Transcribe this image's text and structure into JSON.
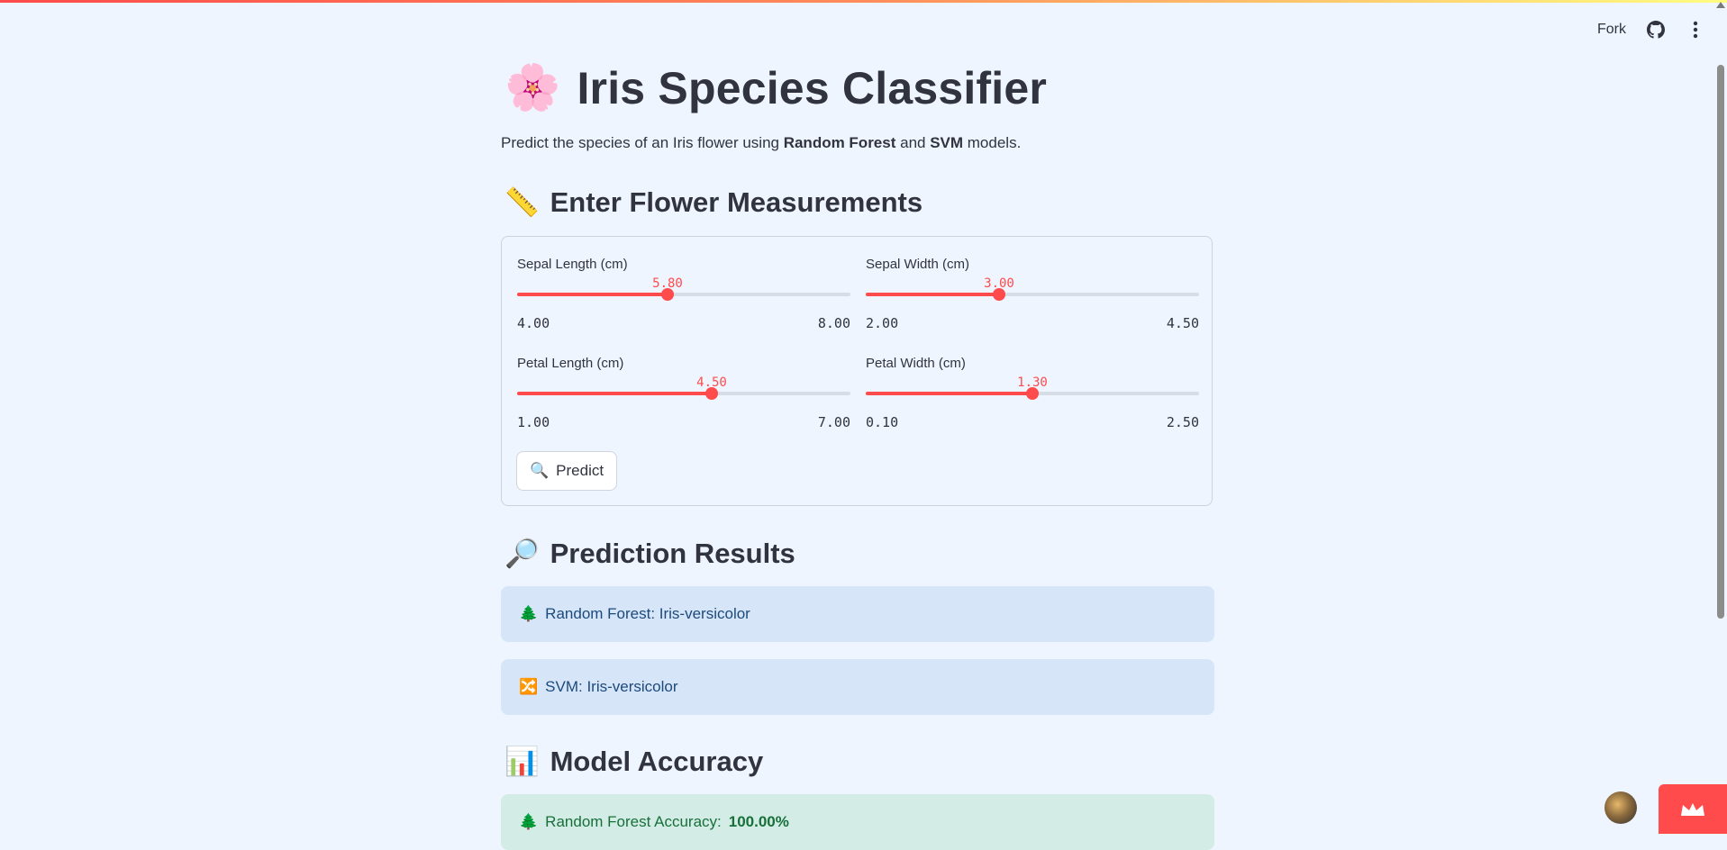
{
  "toolbar": {
    "fork_label": "Fork"
  },
  "title": {
    "emoji": "🌸",
    "text": "Iris Species Classifier"
  },
  "subtitle": {
    "prefix": "Predict the species of an Iris flower using ",
    "rf": "Random Forest",
    "mid": " and ",
    "svm": "SVM",
    "suffix": " models."
  },
  "section_input": {
    "emoji": "📏",
    "text": "Enter Flower Measurements"
  },
  "sliders": [
    {
      "label": "Sepal Length (cm)",
      "value": "5.80",
      "min": "4.00",
      "max": "8.00",
      "fraction": 0.45
    },
    {
      "label": "Sepal Width (cm)",
      "value": "3.00",
      "min": "2.00",
      "max": "4.50",
      "fraction": 0.4
    },
    {
      "label": "Petal Length (cm)",
      "value": "4.50",
      "min": "1.00",
      "max": "7.00",
      "fraction": 0.5833
    },
    {
      "label": "Petal Width (cm)",
      "value": "1.30",
      "min": "0.10",
      "max": "2.50",
      "fraction": 0.5
    }
  ],
  "predict_button": {
    "emoji": "🔍",
    "label": "Predict"
  },
  "section_results": {
    "emoji": "🔎",
    "text": "Prediction Results"
  },
  "results": [
    {
      "emoji": "🌲",
      "text": "Random Forest: Iris-versicolor"
    },
    {
      "emoji": "🔀",
      "text": "SVM: Iris-versicolor"
    }
  ],
  "section_accuracy": {
    "emoji": "📊",
    "text": "Model Accuracy"
  },
  "accuracy": [
    {
      "emoji": "🌲",
      "label": "Random Forest Accuracy: ",
      "value": "100.00%"
    }
  ],
  "colors": {
    "accent": "#ff4b4b",
    "background": "#eef5ff",
    "info_bg": "#d6e6f8",
    "success_bg": "#d4ece6"
  }
}
